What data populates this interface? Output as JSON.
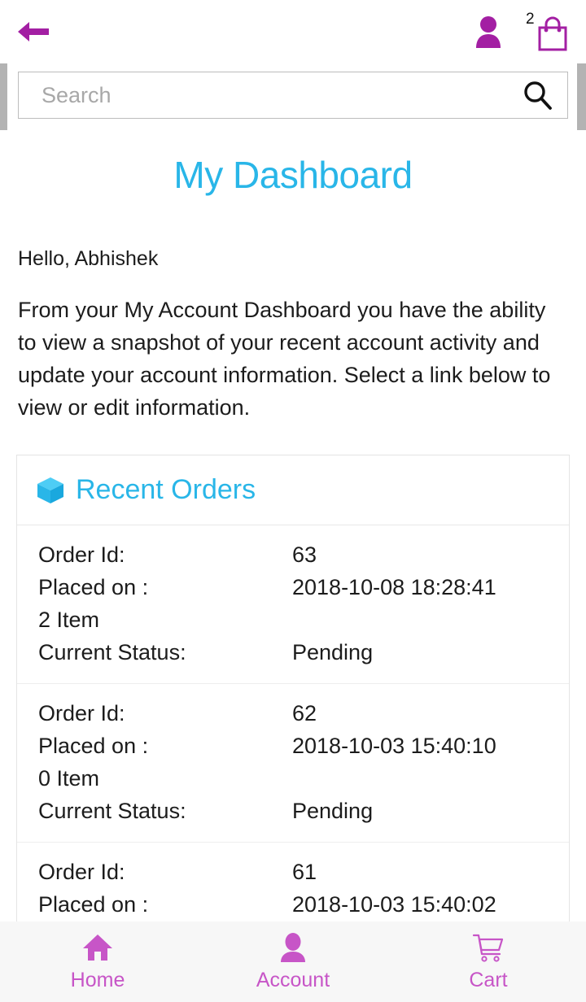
{
  "header": {
    "back_icon": "arrow-left-icon",
    "account_icon": "person-icon",
    "cart_icon": "shopping-bag-icon",
    "cart_badge": "2",
    "accent_color": "#a31fa3"
  },
  "search": {
    "placeholder": "Search",
    "value": "",
    "icon": "search-icon"
  },
  "main": {
    "title": "My Dashboard",
    "title_color": "#29b6e8",
    "greeting": "Hello, Abhishek",
    "intro": "From your My Account Dashboard you have the ability to view a snapshot of your recent account activity and update your account information. Select a link below to view or edit information."
  },
  "recent_orders": {
    "icon": "box-cube-icon",
    "heading": "Recent Orders",
    "labels": {
      "order_id": "Order Id:",
      "placed_on": "Placed on :",
      "status": "Current Status:"
    },
    "orders": [
      {
        "id": "63",
        "placed_on": "2018-10-08 18:28:41",
        "items": "2 Item",
        "status": "Pending"
      },
      {
        "id": "62",
        "placed_on": "2018-10-03 15:40:10",
        "items": "0 Item",
        "status": "Pending"
      },
      {
        "id": "61",
        "placed_on": "2018-10-03 15:40:02",
        "items": "",
        "status": ""
      }
    ]
  },
  "bottom_nav": {
    "color": "#c755c7",
    "items": [
      {
        "label": "Home",
        "icon": "home-icon"
      },
      {
        "label": "Account",
        "icon": "person-icon"
      },
      {
        "label": "Cart",
        "icon": "shopping-cart-icon"
      }
    ]
  }
}
